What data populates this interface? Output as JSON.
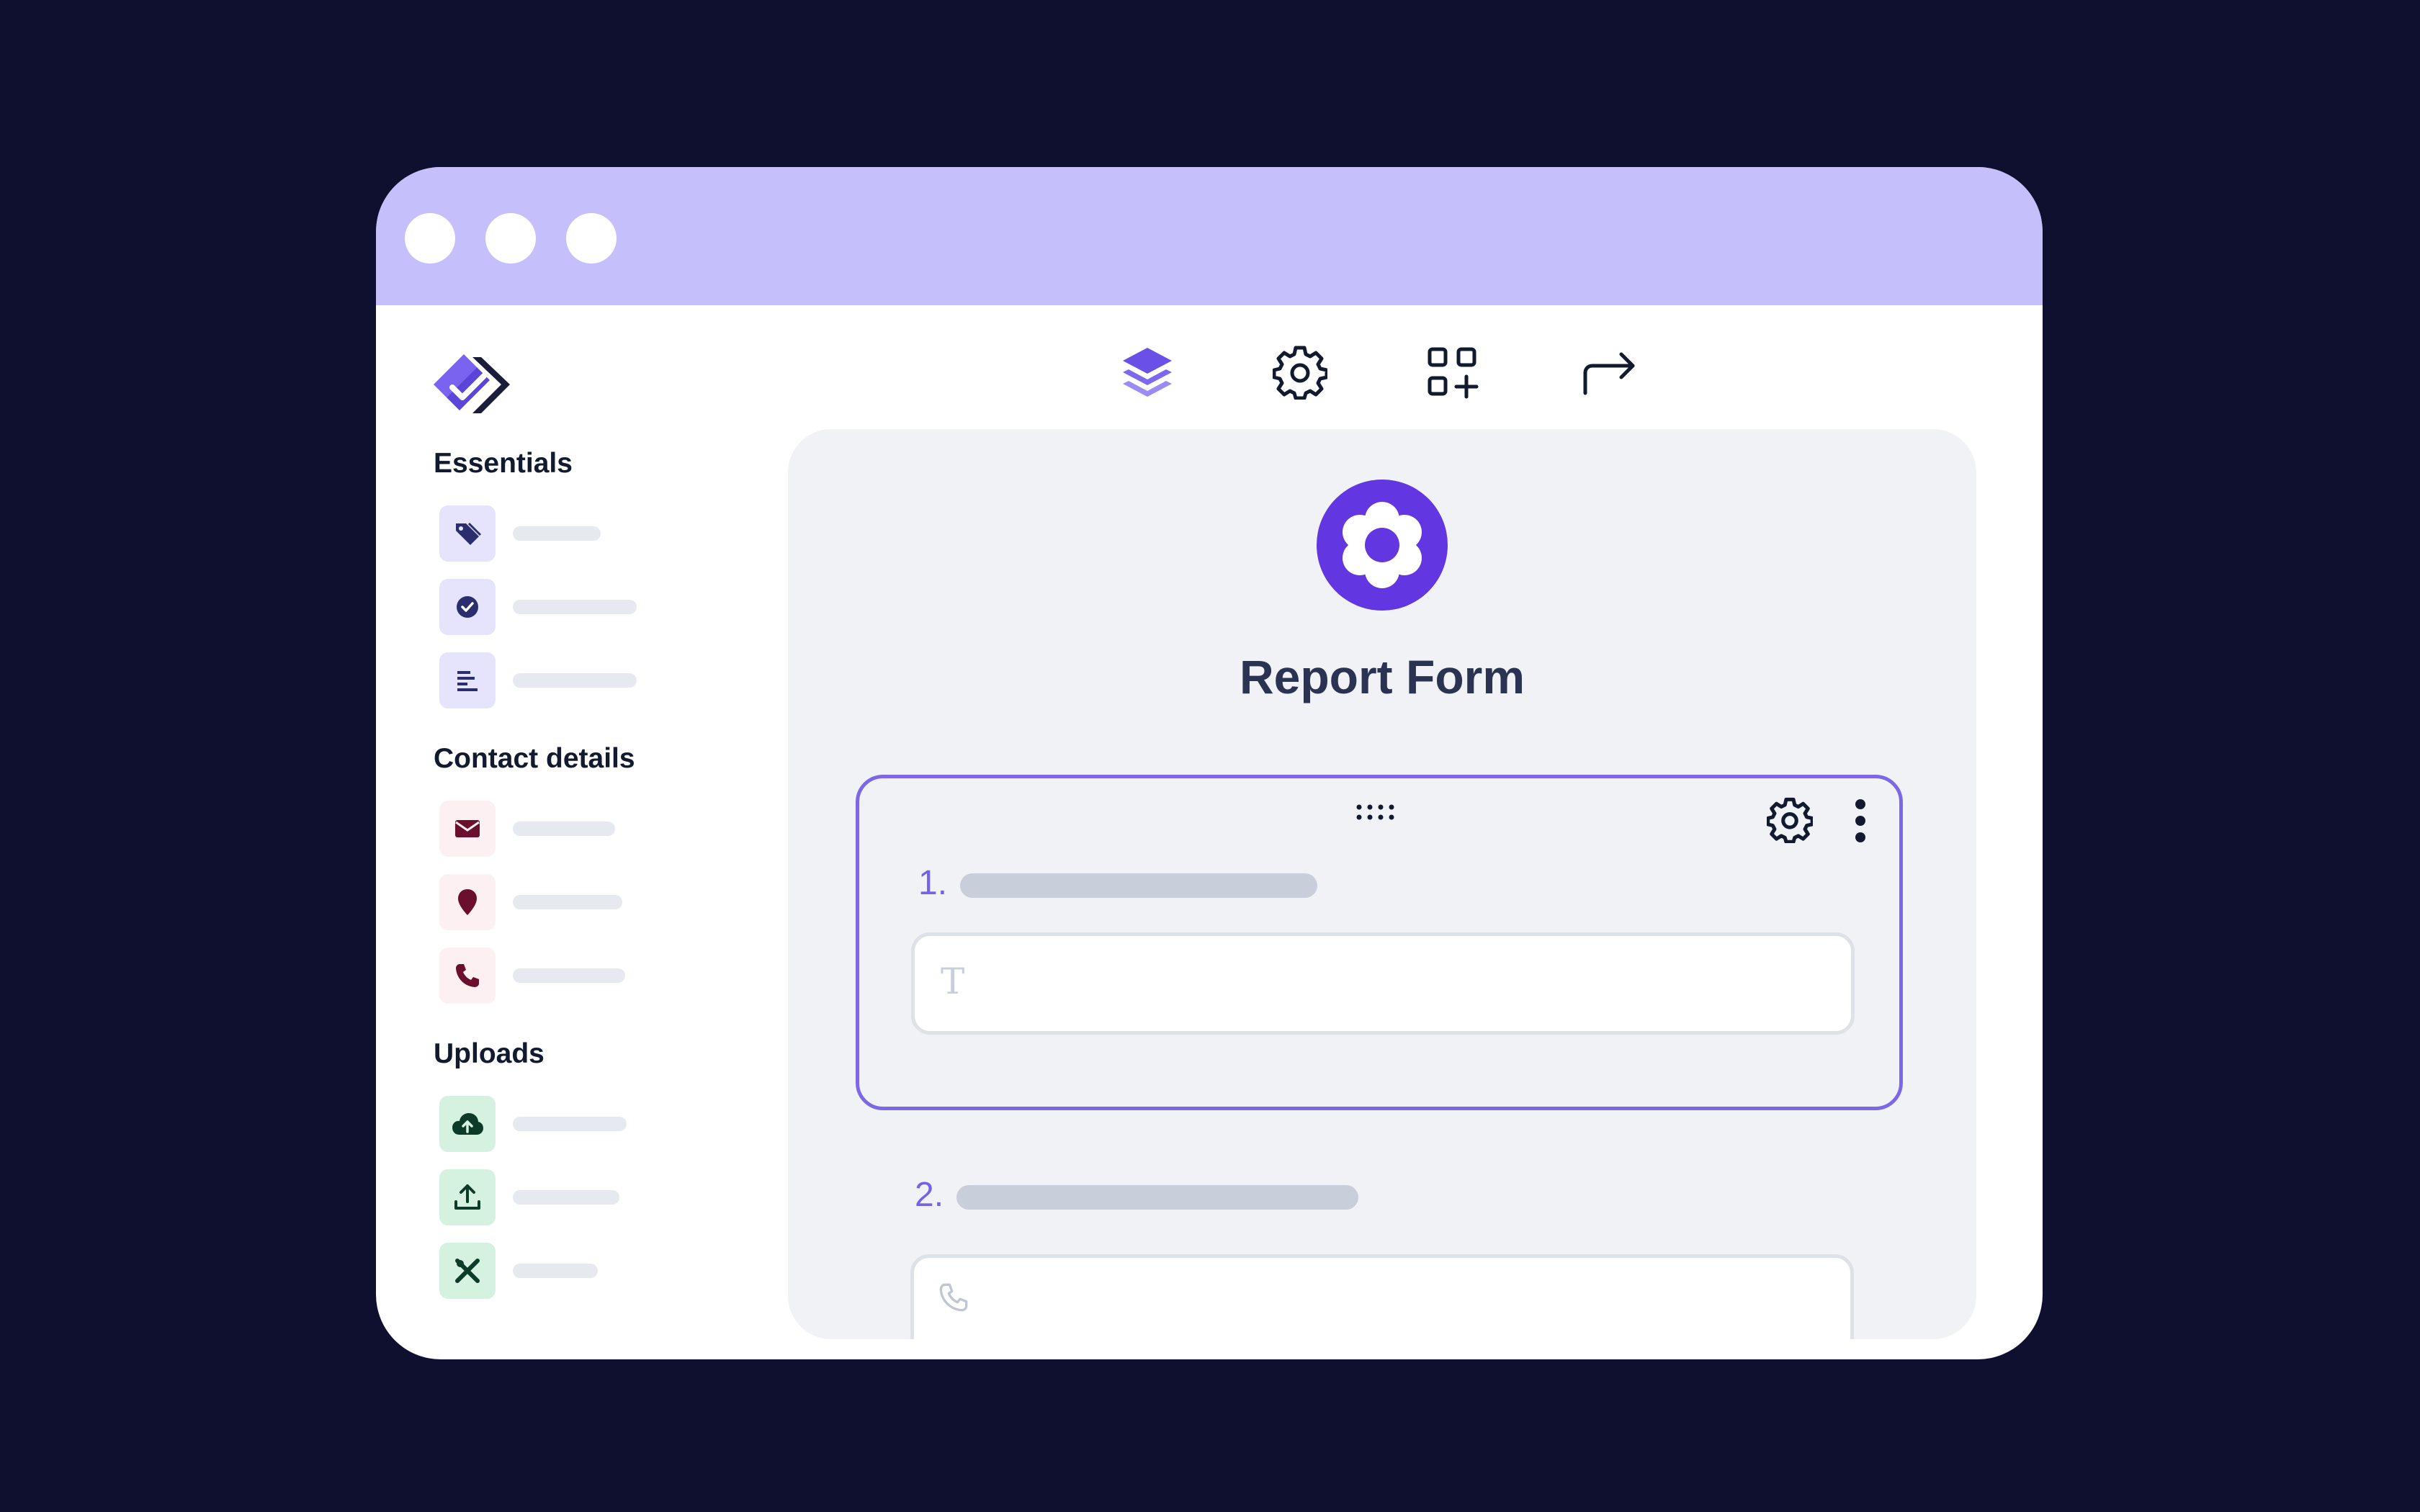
{
  "sidebar": {
    "sections": [
      {
        "title": "Essentials"
      },
      {
        "title": "Contact details"
      },
      {
        "title": "Uploads"
      }
    ],
    "items": [
      {
        "icon": "tag-icon",
        "bar_fraction": 0.55
      },
      {
        "icon": "check-circle-icon",
        "bar_fraction": 1.0
      },
      {
        "icon": "paragraph-icon",
        "bar_fraction": 1.0
      },
      {
        "icon": "mail-icon",
        "bar_fraction": 0.8
      },
      {
        "icon": "location-pin-icon",
        "bar_fraction": 0.85
      },
      {
        "icon": "phone-icon",
        "bar_fraction": 0.88
      },
      {
        "icon": "cloud-upload-icon",
        "bar_fraction": 0.9
      },
      {
        "icon": "upload-icon",
        "bar_fraction": 0.85
      },
      {
        "icon": "design-tools-icon",
        "bar_fraction": 0.68
      }
    ]
  },
  "toolbar": {
    "icons": [
      "layers-icon",
      "gear-icon",
      "add-widget-icon",
      "share-icon"
    ]
  },
  "form": {
    "title": "Report Form",
    "questions": [
      {
        "number": "1.",
        "input_glyph": "T",
        "input_type": "text"
      },
      {
        "number": "2.",
        "input_glyph": "phone",
        "input_type": "phone"
      }
    ]
  },
  "colors": {
    "background": "#0f1030",
    "titlebar": "#c5bffc",
    "accent": "#6236e0",
    "selected_border": "#7d67e8",
    "essentials_icon_bg": "#e6e3fd",
    "contact_icon_bg": "#fdf0f3",
    "uploads_icon_bg": "#d4f2df"
  }
}
